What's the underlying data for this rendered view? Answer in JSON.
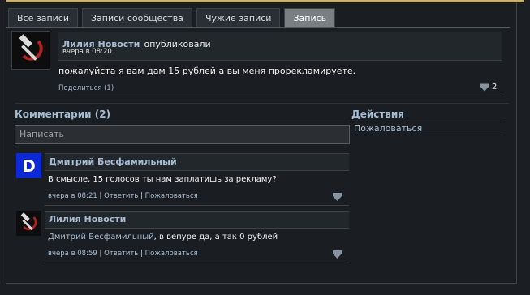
{
  "tabs": [
    {
      "label": "Все записи",
      "active": false
    },
    {
      "label": "Записи сообщества",
      "active": false
    },
    {
      "label": "Чужие записи",
      "active": false
    },
    {
      "label": "Запись",
      "active": true
    }
  ],
  "post": {
    "author": "Лилия Новости",
    "action": "опубликовали",
    "time": "вчера в 08:20",
    "text": "пожалуйста я вам дам 15 рублей а вы меня прорекламируете.",
    "share_label": "Поделиться",
    "share_count": "(1)",
    "votes": "2"
  },
  "comments_section": {
    "title": "Комментарии (2)",
    "input_placeholder": "Написать"
  },
  "actions_section": {
    "title": "Действия",
    "complain": "Пожаловаться"
  },
  "comments": [
    {
      "author": "Дмитрий Бесфамильный",
      "avatar_letter": "D",
      "text": "В смысле, 15 голосов ты нам заплатишь за рекламу?",
      "time": "вчера в 08:21",
      "reply": "Ответить",
      "complain": "Пожаловаться"
    },
    {
      "author": "Лилия Новости",
      "mention": "Дмитрий Бесфамильный",
      "text": ", в вепуре да, а так 0 рублей",
      "time": "вчера в 08:59",
      "reply": "Ответить",
      "complain": "Пожаловаться"
    }
  ],
  "colors": {
    "accent_link": "#a6bcd2",
    "gold_bar": "#c9b26b",
    "avatar_blue": "#0b29d6",
    "hammer_red": "#b32222"
  }
}
